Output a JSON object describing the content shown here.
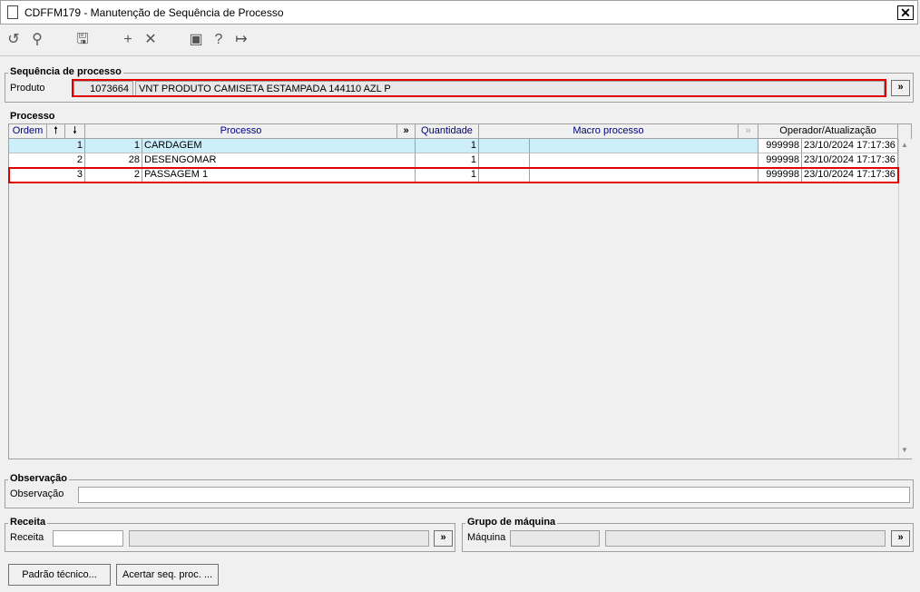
{
  "window": {
    "title": "CDFFM179 - Manutenção de Sequência de Processo",
    "close_glyph": "✕"
  },
  "toolbar": [
    "undo-icon",
    "search-icon",
    "save-icon",
    "add-icon",
    "delete-icon",
    "calendar-icon",
    "help-icon",
    "exit-icon"
  ],
  "sequencia": {
    "legend": "Sequência de processo",
    "produto_label": "Produto",
    "produto_code": "1073664",
    "produto_desc": "VNT PRODUTO CAMISETA ESTAMPADA 144110 AZL P",
    "more_label": "»"
  },
  "processo": {
    "legend": "Processo",
    "headers": {
      "ordem": "Ordem",
      "up": "🠕",
      "down": "🠗",
      "processo": "Processo",
      "more": "»",
      "quantidade": "Quantidade",
      "macro": "Macro processo",
      "operador": "Operador/Atualização"
    },
    "rows": [
      {
        "ordem": "1",
        "cod": "1",
        "processo": "CARDAGEM",
        "quantidade": "1",
        "macro_cod": "",
        "macro": "",
        "operador": "999998",
        "data": "23/10/2024 17:17:36"
      },
      {
        "ordem": "2",
        "cod": "28",
        "processo": "DESENGOMAR",
        "quantidade": "1",
        "macro_cod": "",
        "macro": "",
        "operador": "999998",
        "data": "23/10/2024 17:17:36"
      },
      {
        "ordem": "3",
        "cod": "2",
        "processo": "PASSAGEM 1",
        "quantidade": "1",
        "macro_cod": "",
        "macro": "",
        "operador": "999998",
        "data": "23/10/2024 17:17:36"
      }
    ]
  },
  "observacao": {
    "legend": "Observação",
    "label": "Observação",
    "value": ""
  },
  "receita": {
    "legend": "Receita",
    "label": "Receita",
    "value": "",
    "more_label": "»"
  },
  "grupo": {
    "legend": "Grupo de máquina",
    "label": "Máquina",
    "more_label": "»"
  },
  "buttons": {
    "padrao": "Padrão técnico...",
    "acertar": "Acertar seq. proc. ..."
  }
}
